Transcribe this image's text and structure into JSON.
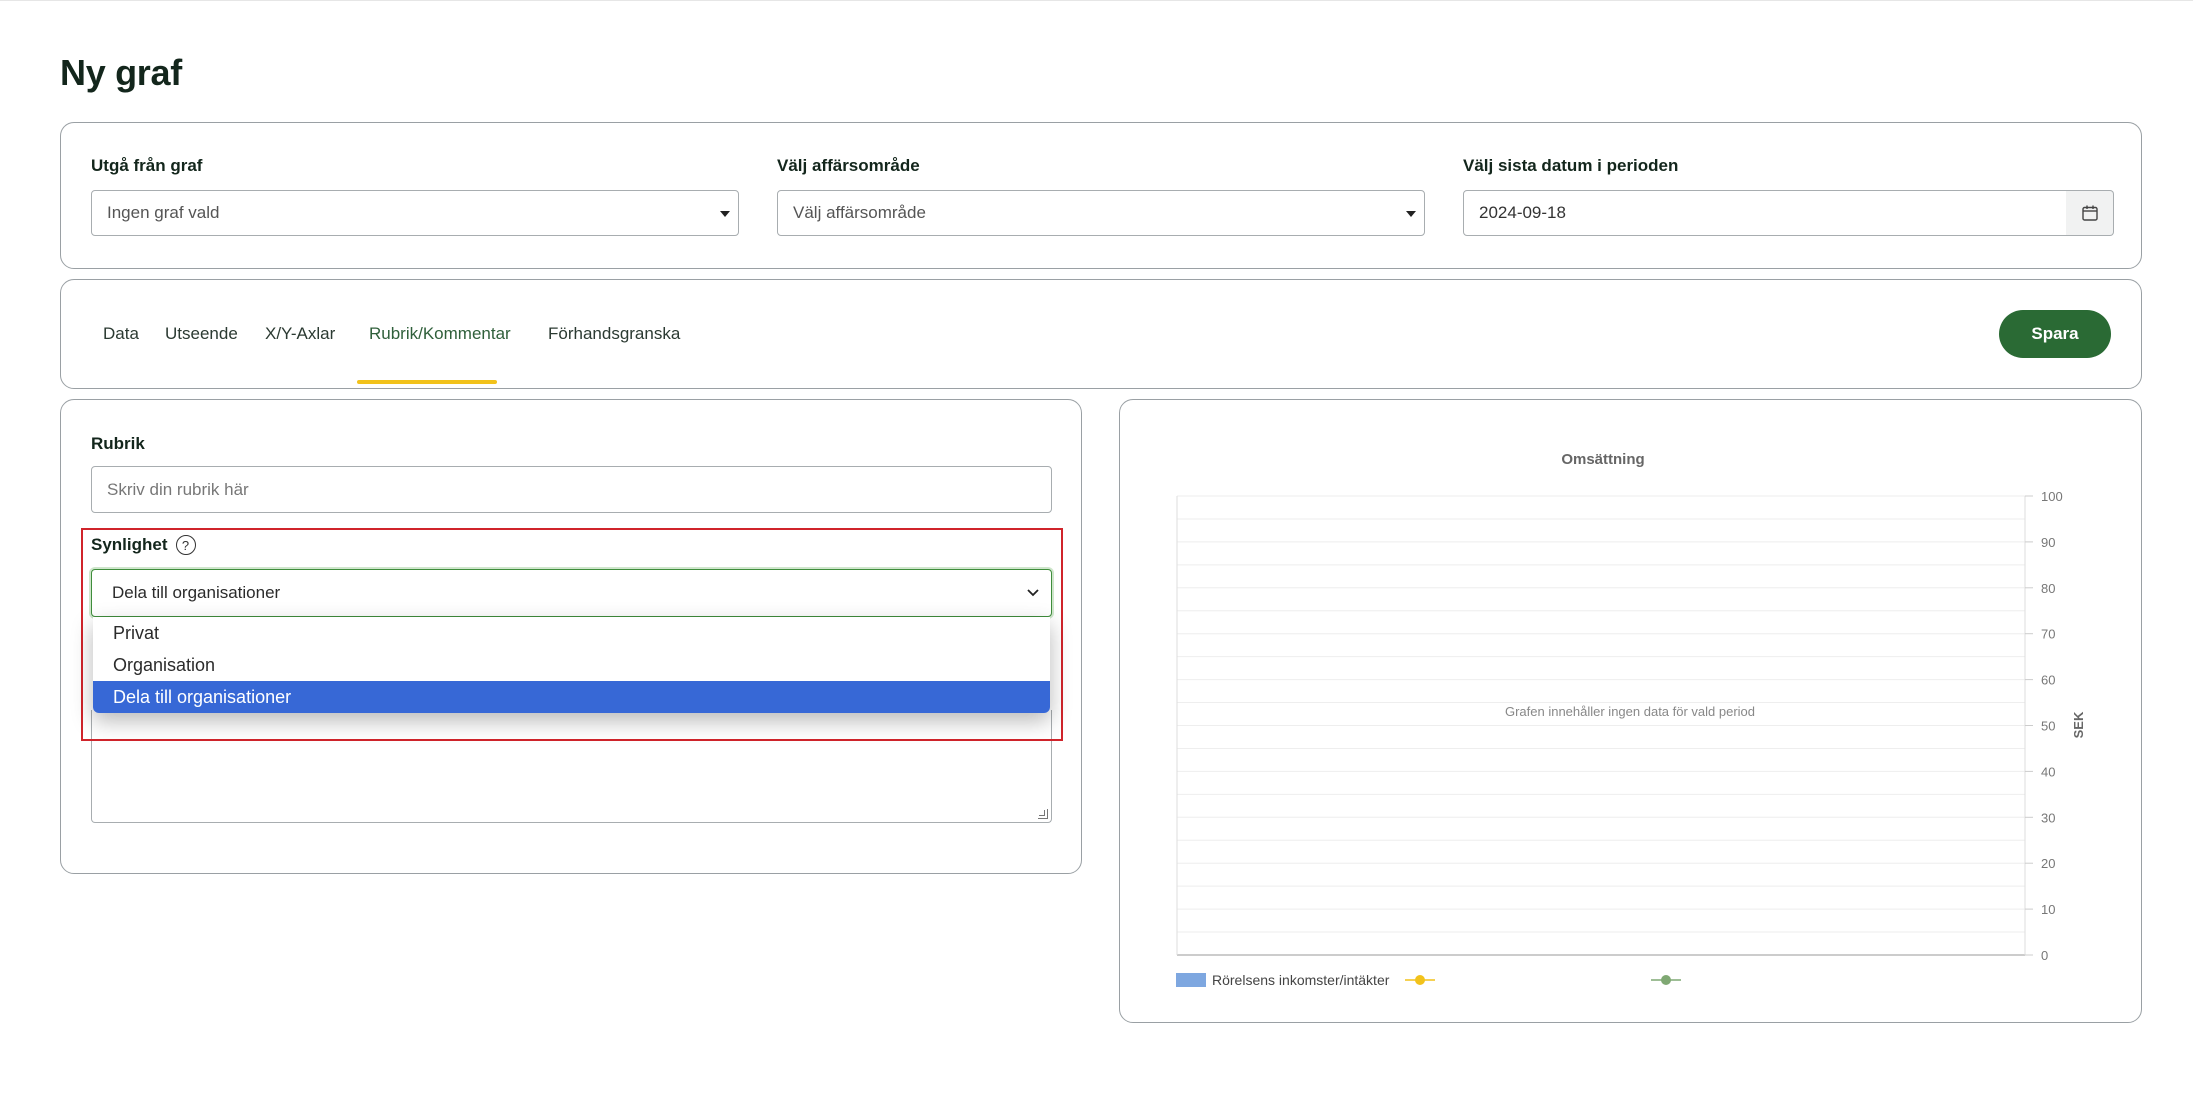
{
  "page": {
    "title": "Ny graf"
  },
  "filters": {
    "base_graph": {
      "label": "Utgå från graf",
      "value": "Ingen graf vald"
    },
    "business_area": {
      "label": "Välj affärsområde",
      "value": "Välj affärsområde"
    },
    "end_date": {
      "label": "Välj sista datum i perioden",
      "value": "2024-09-18"
    }
  },
  "tabs": [
    {
      "label": "Data",
      "active": false
    },
    {
      "label": "Utseende",
      "active": false
    },
    {
      "label": "X/Y-Axlar",
      "active": false
    },
    {
      "label": "Rubrik/Kommentar",
      "active": true
    },
    {
      "label": "Förhandsgranska",
      "active": false
    }
  ],
  "toolbar": {
    "save_label": "Spara"
  },
  "form": {
    "heading_label": "Rubrik",
    "heading_placeholder": "Skriv din rubrik här",
    "visibility_label": "Synlighet",
    "visibility_help": "?",
    "visibility_value": "Dela till organisationer",
    "visibility_options": [
      "Privat",
      "Organisation",
      "Dela till organisationer"
    ],
    "visibility_selected_index": 2
  },
  "colors": {
    "accent_green": "#2a6a34",
    "tab_underline": "#f2c21b",
    "highlight_red": "#d0242b",
    "selected_option": "#3768d6"
  },
  "chart_data": {
    "type": "bar",
    "title": "Omsättning",
    "empty_message": "Grafen innehåller ingen data för vald period",
    "ylabel": "SEK",
    "ylim": [
      0,
      100
    ],
    "yticks": [
      0,
      10,
      20,
      30,
      40,
      50,
      60,
      70,
      80,
      90,
      100
    ],
    "y_axis_side": "right",
    "grid": true,
    "categories": [],
    "series": [
      {
        "name": "Rörelsens inkomster/intäkter",
        "type": "bar",
        "color": "#7ea7e0",
        "values": []
      },
      {
        "type": "line",
        "color": "#f2c21b",
        "values": []
      },
      {
        "type": "line",
        "color": "#7fa873",
        "values": []
      }
    ],
    "legend": "bottom"
  }
}
